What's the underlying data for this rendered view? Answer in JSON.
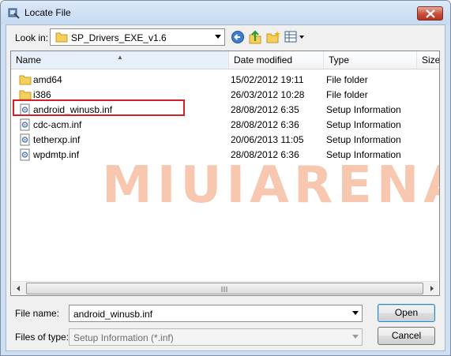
{
  "window": {
    "title": "Locate File",
    "close_icon": "close-icon"
  },
  "lookin": {
    "label": "Look in:",
    "value": "SP_Drivers_EXE_v1.6"
  },
  "toolbar": {
    "icons": [
      "back-icon",
      "up-folder-icon",
      "new-folder-icon",
      "view-menu-icon"
    ]
  },
  "columns": {
    "name": "Name",
    "date": "Date modified",
    "type": "Type",
    "size": "Size"
  },
  "files": [
    {
      "name": "amd64",
      "date": "15/02/2012 19:11",
      "type": "File folder",
      "icon": "folder-icon"
    },
    {
      "name": "i386",
      "date": "26/03/2012 10:28",
      "type": "File folder",
      "icon": "folder-icon"
    },
    {
      "name": "android_winusb.inf",
      "date": "28/08/2012 6:35",
      "type": "Setup Information",
      "icon": "setup-file-icon"
    },
    {
      "name": "cdc-acm.inf",
      "date": "28/08/2012 6:36",
      "type": "Setup Information",
      "icon": "setup-file-icon"
    },
    {
      "name": "tetherxp.inf",
      "date": "20/06/2013 11:05",
      "type": "Setup Information",
      "icon": "setup-file-icon"
    },
    {
      "name": "wpdmtp.inf",
      "date": "28/08/2012 6:36",
      "type": "Setup Information",
      "icon": "setup-file-icon"
    }
  ],
  "highlight_color": "#d32027",
  "watermark": "MIUIARENA",
  "filename": {
    "label": "File name:",
    "value": "android_winusb.inf"
  },
  "filetype": {
    "label": "Files of type:",
    "value": "Setup Information (*.inf)"
  },
  "buttons": {
    "open": "Open",
    "cancel": "Cancel"
  }
}
